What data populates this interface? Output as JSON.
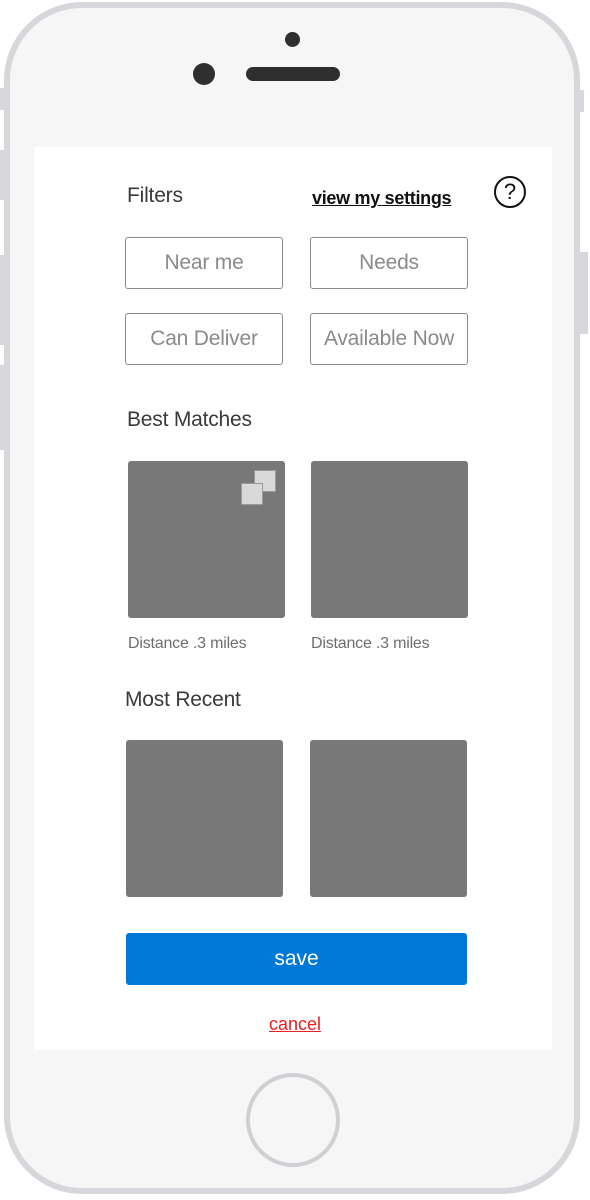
{
  "header": {
    "filters_title": "Filters",
    "settings_link": "view my settings",
    "help_icon": "question-circle-icon",
    "help_glyph": "?"
  },
  "filters": [
    {
      "label": "Near me"
    },
    {
      "label": "Needs"
    },
    {
      "label": "Can Deliver"
    },
    {
      "label": "Available Now"
    }
  ],
  "best_matches": {
    "title": "Best Matches",
    "items": [
      {
        "distance": "Distance .3 miles",
        "icon": "multiple-images-icon"
      },
      {
        "distance": "Distance .3 miles"
      }
    ]
  },
  "most_recent": {
    "title": "Most Recent"
  },
  "actions": {
    "save_label": "save",
    "cancel_label": "cancel"
  },
  "colors": {
    "primary": "#0078d7",
    "cancel": "#e82020",
    "tile": "#787878",
    "device_frame": "#d6d7da"
  }
}
